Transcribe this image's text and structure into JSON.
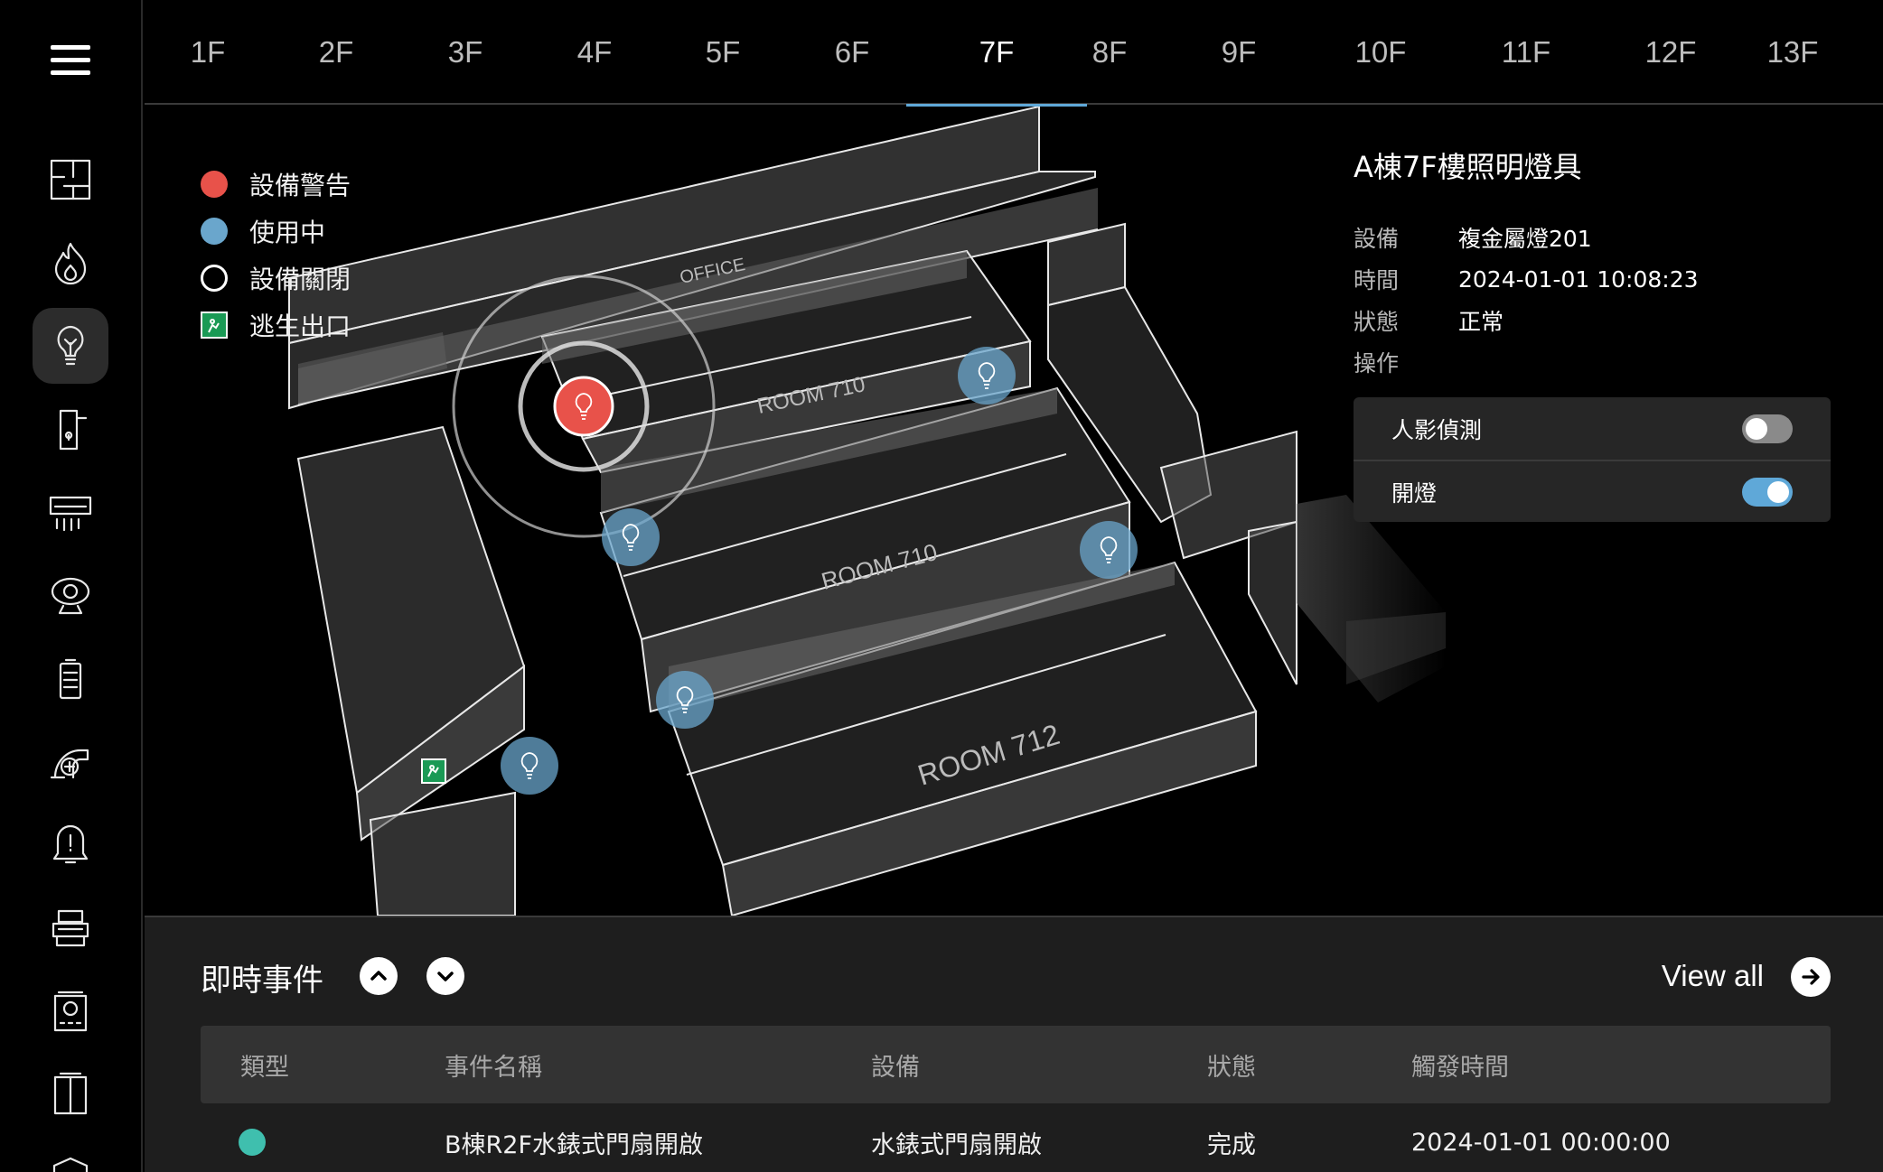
{
  "floors": [
    "1F",
    "2F",
    "3F",
    "4F",
    "5F",
    "6F",
    "7F",
    "8F",
    "9F",
    "10F",
    "11F",
    "12F",
    "13F"
  ],
  "active_floor": "7F",
  "legend": {
    "warning": "設備警告",
    "in_use": "使用中",
    "off": "設備關閉",
    "exit": "逃生出口"
  },
  "map_labels": {
    "office": "OFFICE",
    "room_a": "ROOM 710",
    "room_b": "ROOM 710",
    "room_c": "ROOM 712"
  },
  "info": {
    "title": "A棟7F樓照明燈具",
    "device_key": "設備",
    "device_val": "複金屬燈201",
    "time_key": "時間",
    "time_val": "2024-01-01 10:08:23",
    "status_key": "狀態",
    "status_val": "正常",
    "op_key": "操作",
    "controls": [
      {
        "label": "人影偵測",
        "state": "off"
      },
      {
        "label": "開燈",
        "state": "on"
      }
    ]
  },
  "events": {
    "title": "即時事件",
    "view_all": "View all",
    "columns": [
      "類型",
      "事件名稱",
      "設備",
      "狀態",
      "觸發時間"
    ],
    "rows": [
      {
        "type_color": "#3fbfae",
        "name": "B棟R2F水錶式門扇開啟",
        "device": "水錶式門扇開啟",
        "status": "完成",
        "time": "2024-01-01 00:00:00"
      }
    ]
  },
  "colors": {
    "warning": "#e8524a",
    "in_use": "#6aa6cc",
    "accent": "#5fa8d8",
    "exit": "#1a9a55"
  },
  "sidebar_icons": [
    "floorplan-icon",
    "fire-icon",
    "lightbulb-icon",
    "door-lock-icon",
    "air-conditioner-icon",
    "camera-icon",
    "battery-icon",
    "fan-icon",
    "alarm-bell-icon",
    "printer-icon",
    "panel-icon",
    "elevator-icon",
    "shield-icon"
  ]
}
